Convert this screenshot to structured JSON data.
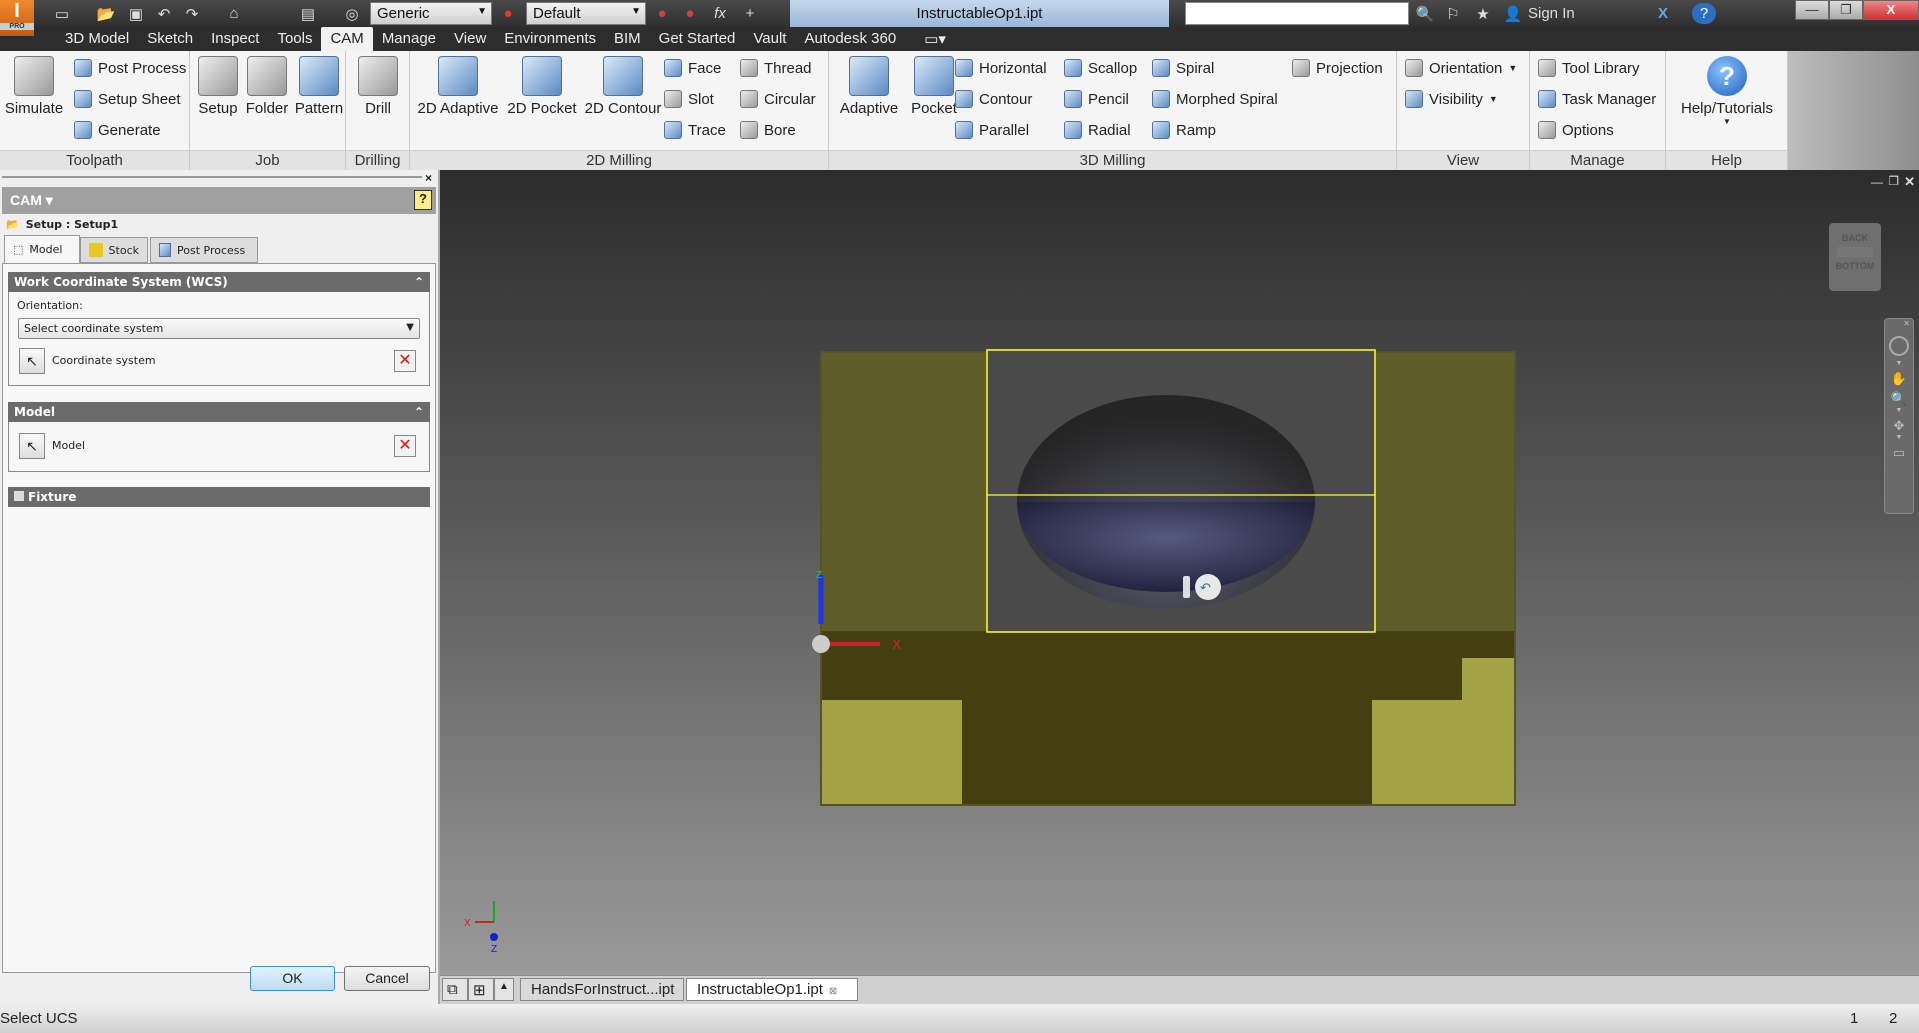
{
  "titlebar": {
    "app_badge": "PRO",
    "material": "Generic",
    "appearance": "Default",
    "title": "InstructableOp1.ipt",
    "search_placeholder": "",
    "sign_in": "Sign In"
  },
  "menu_tabs": [
    "3D Model",
    "Sketch",
    "Inspect",
    "Tools",
    "CAM",
    "Manage",
    "View",
    "Environments",
    "BIM",
    "Get Started",
    "Vault",
    "Autodesk 360"
  ],
  "active_tab": "CAM",
  "ribbon": {
    "toolpath": {
      "label": "Toolpath",
      "simulate": "Simulate",
      "post_process": "Post Process",
      "setup_sheet": "Setup Sheet",
      "generate": "Generate"
    },
    "job": {
      "label": "Job",
      "setup": "Setup",
      "folder": "Folder",
      "pattern": "Pattern"
    },
    "drilling": {
      "label": "Drilling",
      "drill": "Drill"
    },
    "milling2d": {
      "label": "2D Milling",
      "adaptive": "2D Adaptive",
      "pocket": "2D Pocket",
      "contour": "2D Contour",
      "face": "Face",
      "slot": "Slot",
      "trace": "Trace",
      "thread": "Thread",
      "circular": "Circular",
      "bore": "Bore"
    },
    "milling3d": {
      "label": "3D Milling",
      "adaptive": "Adaptive",
      "pocket": "Pocket",
      "horizontal": "Horizontal",
      "contour": "Contour",
      "parallel": "Parallel",
      "scallop": "Scallop",
      "pencil": "Pencil",
      "radial": "Radial",
      "spiral": "Spiral",
      "morphed_spiral": "Morphed Spiral",
      "ramp": "Ramp",
      "projection": "Projection"
    },
    "view": {
      "label": "View",
      "orientation": "Orientation",
      "visibility": "Visibility"
    },
    "manage": {
      "label": "Manage",
      "tool_library": "Tool Library",
      "task_manager": "Task Manager",
      "options": "Options"
    },
    "help": {
      "label": "Help",
      "help_tutorials": "Help/Tutorials"
    }
  },
  "panel": {
    "header": "CAM",
    "setup": "Setup : Setup1",
    "tabs": [
      "Model",
      "Stock",
      "Post Process"
    ],
    "wcs": {
      "title": "Work Coordinate System (WCS)",
      "orientation_label": "Orientation:",
      "orientation_value": "Select coordinate system",
      "pick_label": "Coordinate system"
    },
    "model": {
      "title": "Model",
      "pick_label": "Model"
    },
    "fixture": {
      "title": "Fixture"
    },
    "ok": "OK",
    "cancel": "Cancel"
  },
  "viewcube": {
    "top": "BACK",
    "bottom": "BOTTOM"
  },
  "triad": {
    "x": "X",
    "y": "Y",
    "z": "Z"
  },
  "doc_tabs": [
    "HandsForInstruct...ipt",
    "InstructableOp1.ipt"
  ],
  "active_doc": "InstructableOp1.ipt",
  "status": {
    "text": "Select UCS",
    "n1": "1",
    "n2": "2"
  },
  "colors": {
    "stock": "#6b6a2c",
    "stock_light": "#a3a244",
    "selection": "#ffff33",
    "cavity": "#3d3f6a",
    "accent": "#3b7fd0"
  }
}
